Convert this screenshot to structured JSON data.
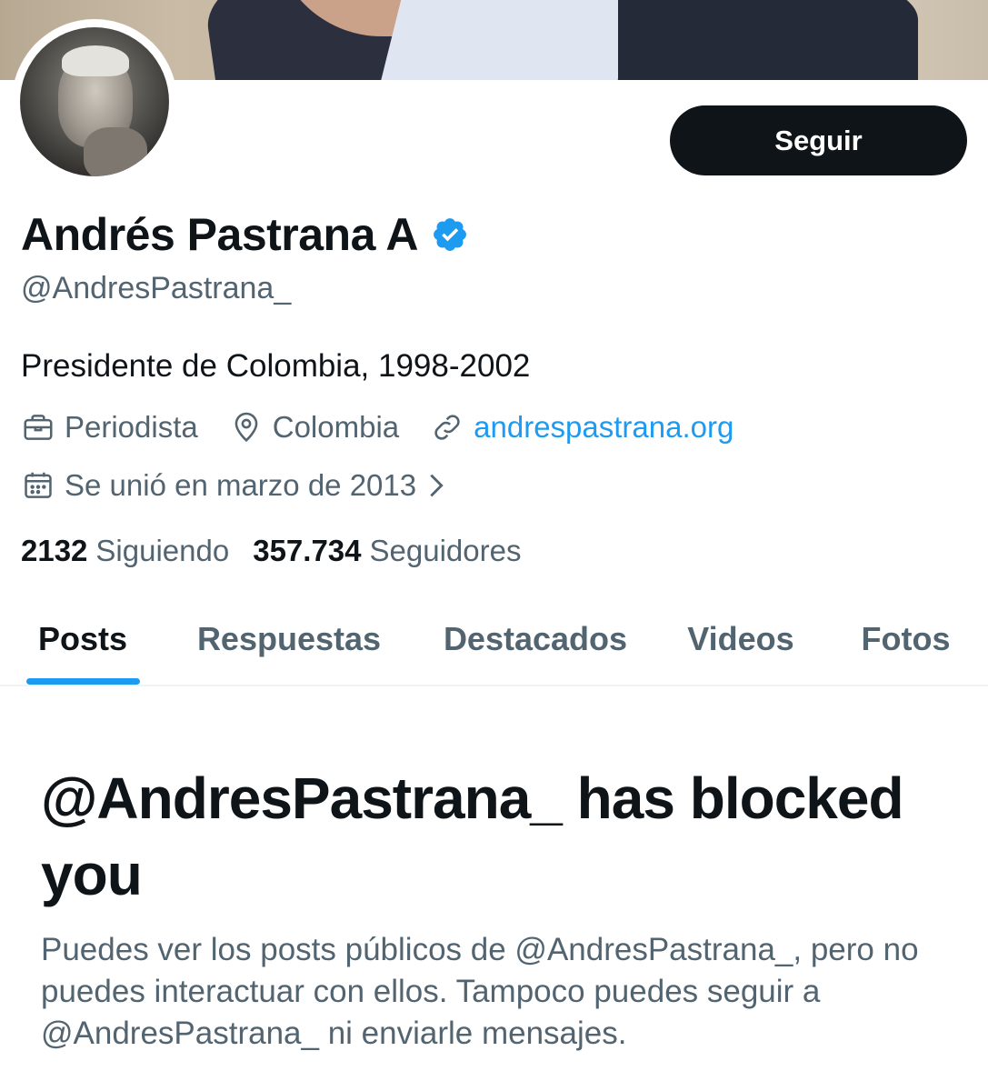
{
  "profile": {
    "display_name": "Andrés Pastrana A",
    "handle": "@AndresPastrana_",
    "bio": "Presidente de Colombia, 1998-2002",
    "profession": "Periodista",
    "location": "Colombia",
    "website": "andrespastrana.org",
    "joined": "Se unió en marzo de 2013",
    "verified_color": "#1d9bf0"
  },
  "actions": {
    "follow_label": "Seguir"
  },
  "stats": {
    "following_count": "2132",
    "following_label": "Siguiendo",
    "followers_count": "357.734",
    "followers_label": "Seguidores"
  },
  "tabs": [
    {
      "label": "Posts",
      "active": true
    },
    {
      "label": "Respuestas",
      "active": false
    },
    {
      "label": "Destacados",
      "active": false
    },
    {
      "label": "Videos",
      "active": false
    },
    {
      "label": "Fotos",
      "active": false
    }
  ],
  "blocked": {
    "title": "@AndresPastrana_ has blocked you",
    "description": "Puedes ver los posts públicos de @AndresPastrana_, pero no puedes interactuar con ellos. Tampoco puedes seguir a @AndresPastrana_ ni enviarle mensajes."
  },
  "colors": {
    "accent": "#1d9bf0",
    "text_primary": "#0f1419",
    "text_secondary": "#536471"
  },
  "icons": [
    "verified-badge-icon",
    "briefcase-icon",
    "location-pin-icon",
    "link-icon",
    "calendar-icon",
    "chevron-right-icon"
  ]
}
